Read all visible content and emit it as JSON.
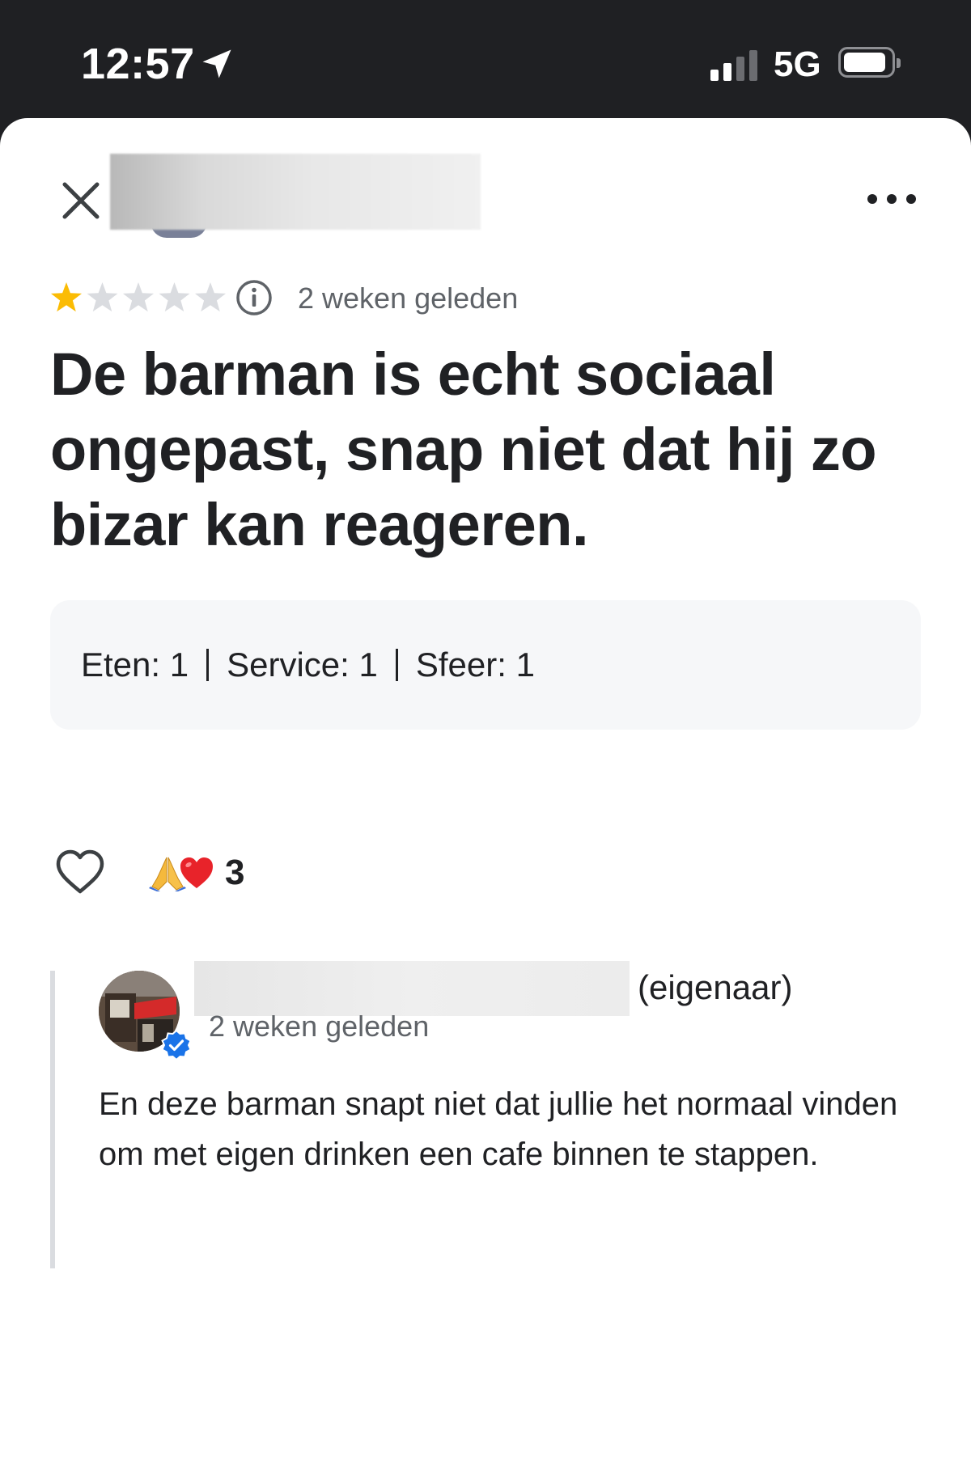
{
  "status_bar": {
    "time": "12:57",
    "network": "5G",
    "location_icon": "location-arrow-icon",
    "signal_icon": "cellular-signal-icon",
    "signal_bars_active": 2,
    "signal_bars_total": 4,
    "battery_icon": "battery-icon"
  },
  "header": {
    "close_icon": "close-icon",
    "more_icon": "more-horizontal-icon"
  },
  "review": {
    "rating": 1,
    "rating_max": 5,
    "star_color": "#fbbc04",
    "info_icon": "info-icon",
    "time": "2 weken geleden",
    "text": "De barman is echt sociaal ongepast, snap niet dat hij zo bizar kan reageren.",
    "subratings": [
      {
        "label": "Eten: 1"
      },
      {
        "label": "Service: 1"
      },
      {
        "label": "Sfeer: 1"
      }
    ]
  },
  "reactions": {
    "like_icon": "heart-outline-icon",
    "icons": [
      "folded-hands-emoji",
      "red-heart-emoji"
    ],
    "count": "3"
  },
  "owner_reply": {
    "label": "(eigenaar)",
    "time": "2 weken geleden",
    "verified_icon": "verified-badge-icon",
    "verified_color": "#1a73e8",
    "text": "En deze barman snapt niet dat jullie het normaal vinden om met eigen drinken een cafe binnen te stappen."
  }
}
